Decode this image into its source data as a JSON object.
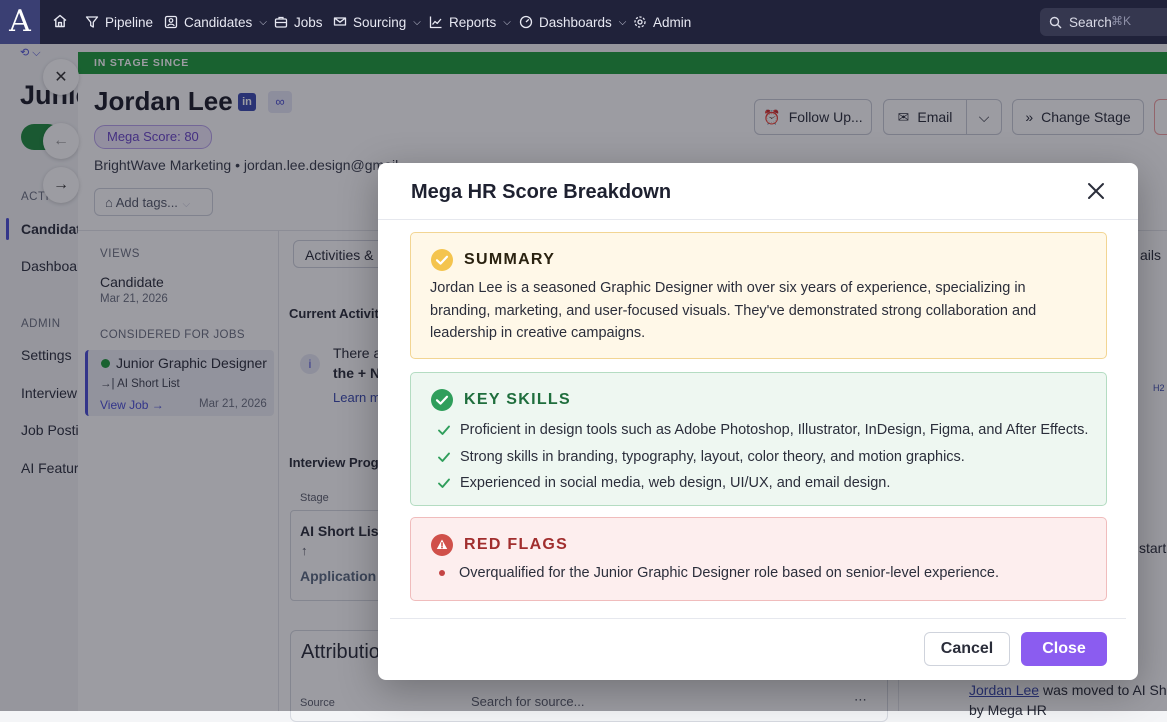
{
  "nav": {
    "logo": "A",
    "items": [
      {
        "label": "Pipeline",
        "icon": "filter-icon",
        "dropdown": false
      },
      {
        "label": "Candidates",
        "icon": "candidates-icon",
        "dropdown": true
      },
      {
        "label": "Jobs",
        "icon": "briefcase-icon",
        "dropdown": false
      },
      {
        "label": "Sourcing",
        "icon": "sourcing-icon",
        "dropdown": true
      },
      {
        "label": "Reports",
        "icon": "chart-icon",
        "dropdown": true
      },
      {
        "label": "Dashboards",
        "icon": "dashboard-icon",
        "dropdown": true
      },
      {
        "label": "Admin",
        "icon": "gear-icon",
        "dropdown": false
      }
    ],
    "search_label": "Search",
    "search_shortcut": "⌘K"
  },
  "sidebar": {
    "title_partial": "Junic",
    "section_activity": "ACTI",
    "items_top": [
      "Candidat",
      "Dashboar"
    ],
    "section_admin": "ADMIN",
    "items_admin": [
      "Settings",
      "Interview",
      "Job Postin",
      "AI Featur"
    ]
  },
  "profile": {
    "stage_banner": "IN STAGE SINCE",
    "name": "Jordan Lee",
    "mega_score": "Mega Score: 80",
    "company": "BrightWave Marketing",
    "email_partial": "jordan.lee.design@gmail",
    "add_tags": "Add tags...",
    "buttons": {
      "follow_up": "Follow Up...",
      "email": "Email",
      "change_stage": "Change Stage"
    },
    "views_label": "VIEWS",
    "candidate_view": "Candidate",
    "candidate_view_date": "Mar 21, 2026",
    "considered_label": "CONSIDERED FOR JOBS",
    "job_title": "Junior Graphic Designer",
    "job_stage": "AI Short List",
    "view_job": "View Job →",
    "job_date": "Mar 21, 2026",
    "tab_partial": "Activities &",
    "right_tab_partial": "ails",
    "current_activity": "Current Activiti",
    "notice_line1": "There a",
    "notice_line2": "the + N",
    "learn_more": "Learn m",
    "interview_progress": "Interview Progr",
    "stage_header": "Stage",
    "stage_current": "AI Short Lis",
    "stage_next": "Application",
    "attribution": "Attributio",
    "source_label": "Source",
    "source_placeholder": "Search for source...",
    "right_start": "start",
    "activity_name": "Jordan Lee",
    "activity_text": "was moved to AI Sh",
    "activity_by": "by Mega HR"
  },
  "modal": {
    "title": "Mega HR Score Breakdown",
    "summary": {
      "heading": "SUMMARY",
      "text": "Jordan Lee is a seasoned Graphic Designer with over six years of experience, specializing in branding, marketing, and user-focused visuals. They've demonstrated strong collaboration and leadership in creative campaigns."
    },
    "key_skills": {
      "heading": "KEY SKILLS",
      "items": [
        "Proficient in design tools such as Adobe Photoshop, Illustrator, InDesign, Figma, and After Effects.",
        "Strong skills in branding, typography, layout, color theory, and motion graphics.",
        "Experienced in social media, web design, UI/UX, and email design."
      ]
    },
    "red_flags": {
      "heading": "RED FLAGS",
      "items": [
        "Overqualified for the Junior Graphic Designer role based on senior-level experience."
      ]
    },
    "cancel_label": "Cancel",
    "close_label": "Close"
  },
  "colors": {
    "nav_bg": "#20223a",
    "stage_green": "#1e9b3c",
    "summary_accent": "#f4c44e",
    "skills_accent": "#2f9e5b",
    "flags_accent": "#d0504a",
    "primary_button": "#8b5cf0"
  }
}
